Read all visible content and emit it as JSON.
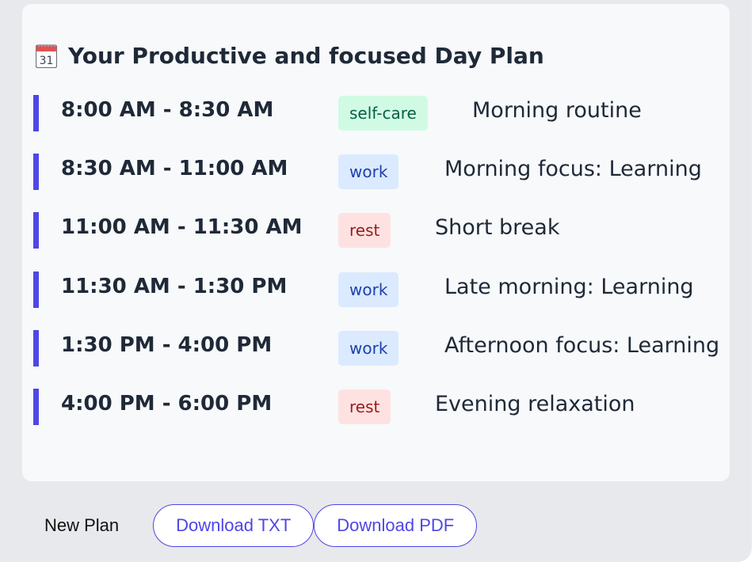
{
  "plan": {
    "title": "Your Productive and focused Day Plan",
    "icon": "calendar-icon",
    "icon_day": "31",
    "accent_color": "#4f46e5",
    "items": [
      {
        "time": "8:00 AM - 8:30 AM",
        "tag": "self-care",
        "description": "Morning routine"
      },
      {
        "time": "8:30 AM - 11:00 AM",
        "tag": "work",
        "description": "Morning focus: Learning"
      },
      {
        "time": "11:00 AM - 11:30 AM",
        "tag": "rest",
        "description": "Short break"
      },
      {
        "time": "11:30 AM - 1:30 PM",
        "tag": "work",
        "description": "Late morning: Learning"
      },
      {
        "time": "1:30 PM - 4:00 PM",
        "tag": "work",
        "description": "Afternoon focus: Learning"
      },
      {
        "time": "4:00 PM - 6:00 PM",
        "tag": "rest",
        "description": "Evening relaxation"
      }
    ],
    "tag_colors": {
      "self-care": {
        "bg": "#d1fae5",
        "fg": "#065f46"
      },
      "work": {
        "bg": "#dbeafe",
        "fg": "#1e40af"
      },
      "rest": {
        "bg": "#fee2e2",
        "fg": "#991b1b"
      }
    }
  },
  "footer": {
    "new_plan_label": "New Plan",
    "download_txt_label": "Download TXT",
    "download_pdf_label": "Download PDF"
  }
}
